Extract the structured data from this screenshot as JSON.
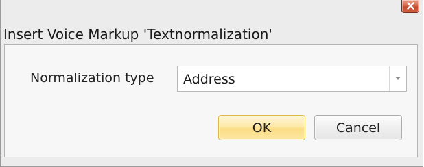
{
  "window": {
    "title": "Insert Voice Markup 'Textnormalization'",
    "close_icon": "close-icon"
  },
  "form": {
    "normalization_type_label": "Normalization type",
    "normalization_type_value": "Address",
    "dropdown_icon": "chevron-down-icon"
  },
  "buttons": {
    "ok_label": "OK",
    "cancel_label": "Cancel"
  },
  "colors": {
    "close_button": "#d0613f",
    "ok_button": "#fbdc85",
    "dialog_background": "#ececec",
    "content_background": "#f7f7f7"
  }
}
